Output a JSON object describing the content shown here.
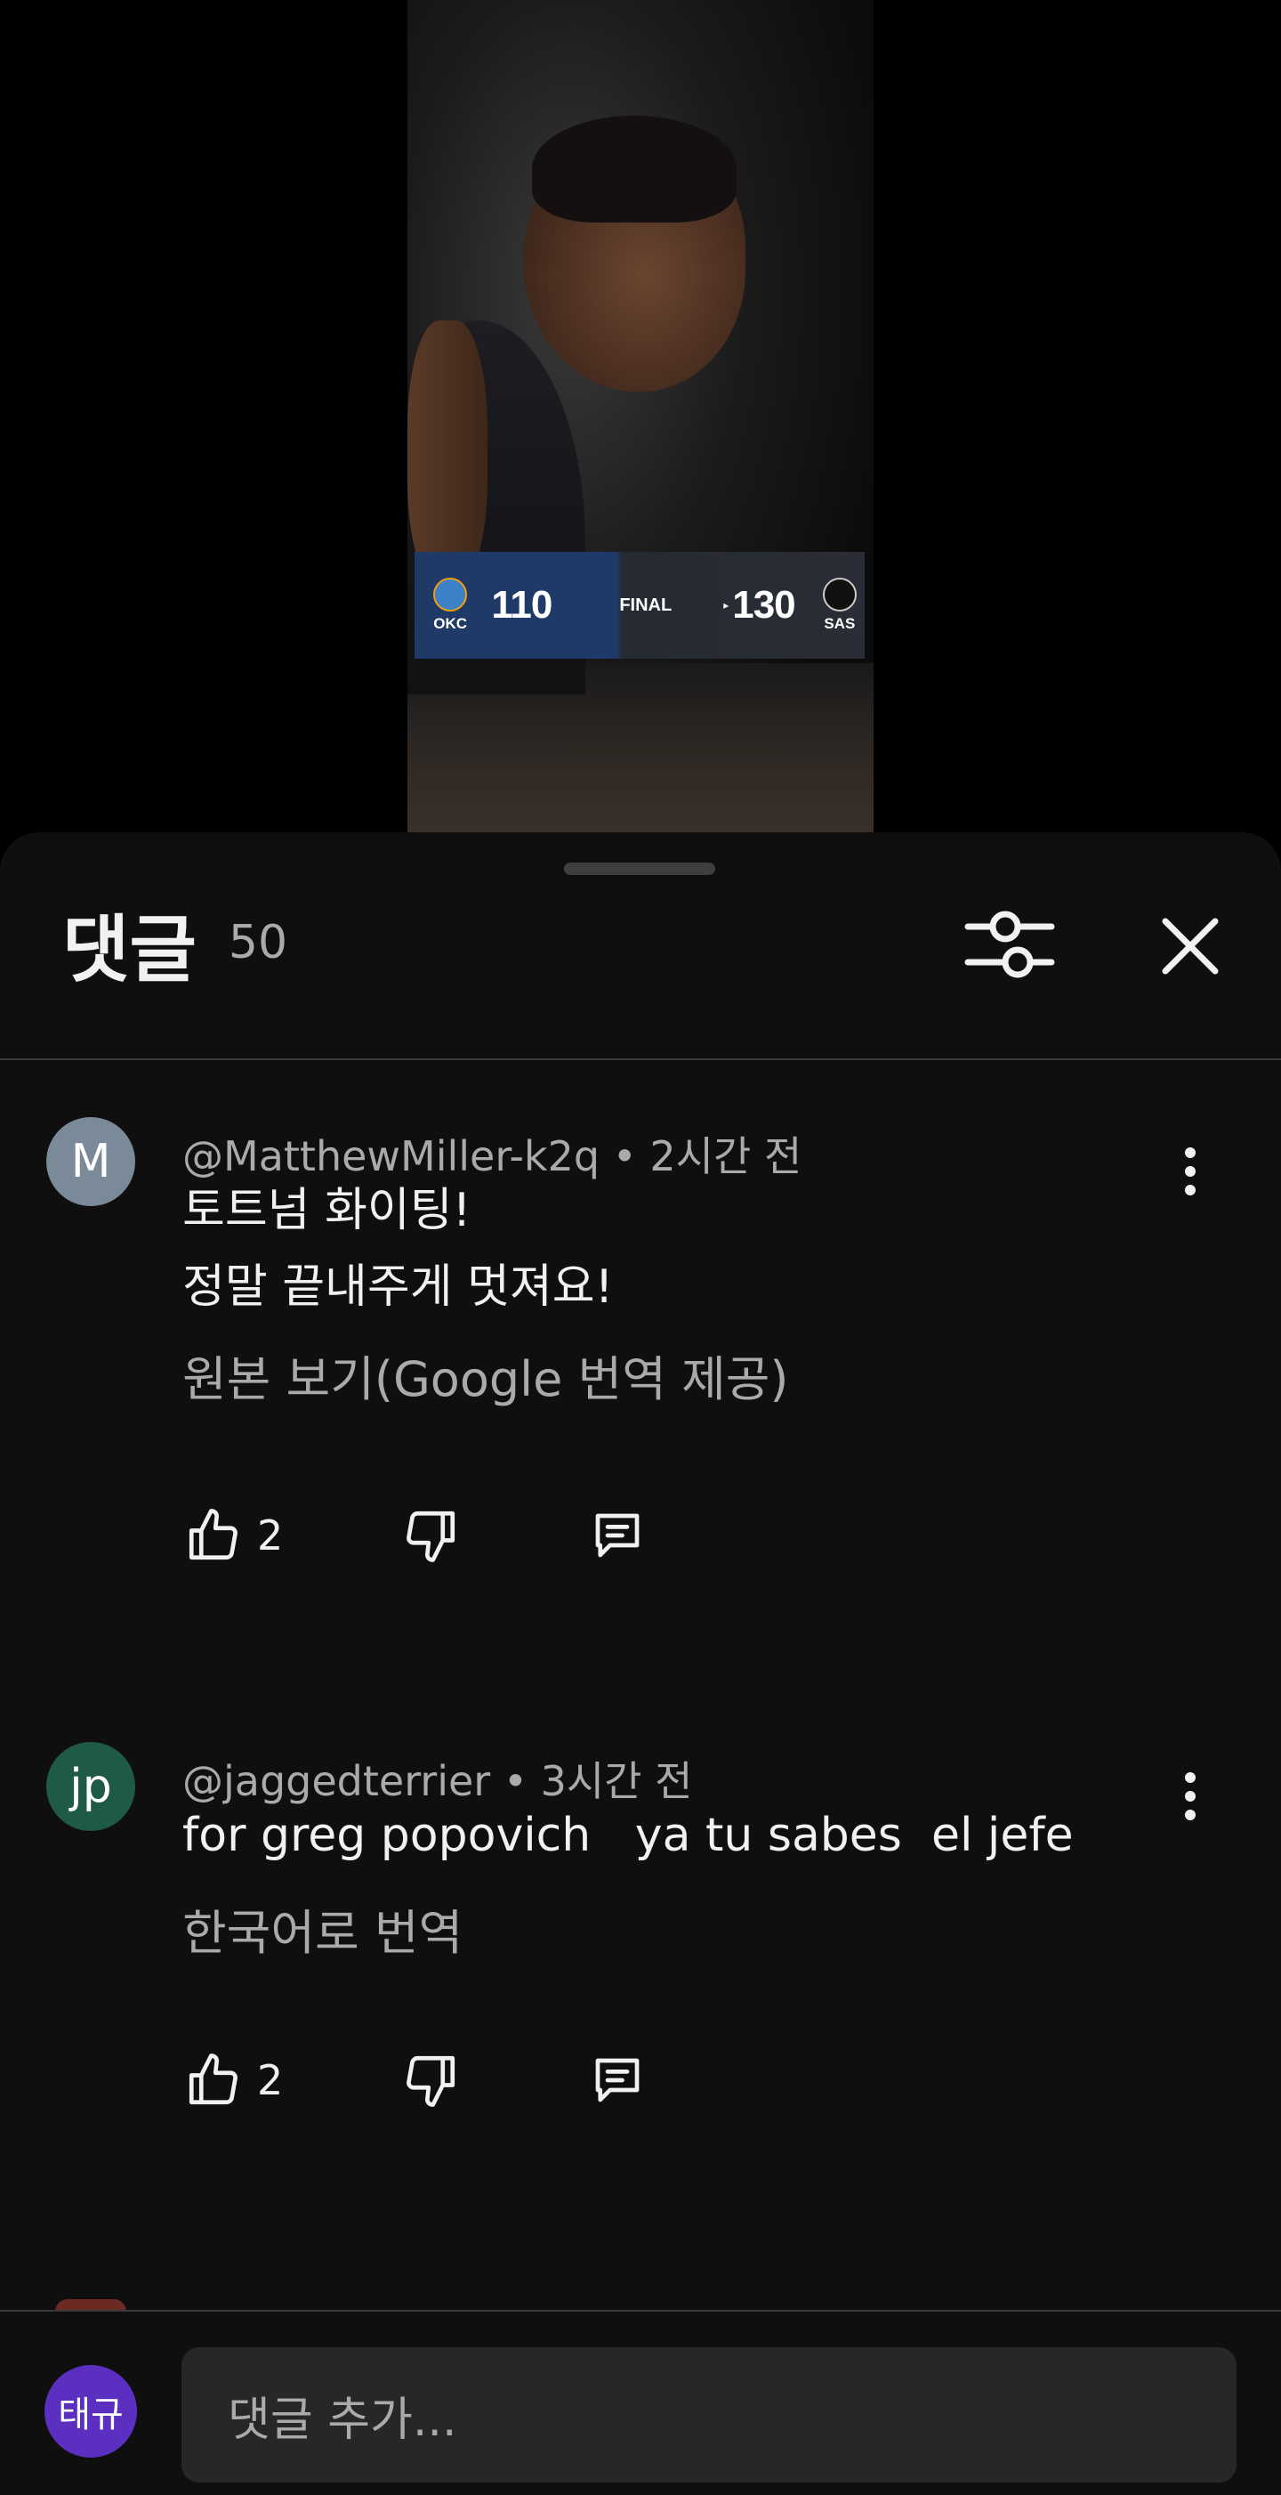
{
  "video": {
    "scoreboard": {
      "away_abbr": "OKC",
      "away_score": "110",
      "status": "FINAL",
      "home_score": "130",
      "home_abbr": "SAS"
    }
  },
  "comments_panel": {
    "title": "댓글",
    "count": "50",
    "filter_icon": "sliders-icon",
    "close_icon": "close-icon"
  },
  "comments": [
    {
      "avatar_letter": "M",
      "avatar_color": "#7a8a99",
      "author": "@MatthewMiller-k2q",
      "time": "• 2시간 전",
      "text": "토트넘 화이팅!\n정말 끝내주게 멋져요!",
      "translation_link": "원본 보기(Google 번역 제공)",
      "likes": "2"
    },
    {
      "avatar_letter": "jp",
      "avatar_color": "#1f5a45",
      "author": "@jaggedterrier",
      "time": "• 3시간 전",
      "text": "for greg popovich   ya tu sabes  el jefe",
      "translation_link": "한국어로 번역",
      "likes": "2"
    }
  ],
  "composer": {
    "avatar_text": "태규",
    "avatar_color": "#5b2fbf",
    "placeholder": "댓글 추가..."
  }
}
